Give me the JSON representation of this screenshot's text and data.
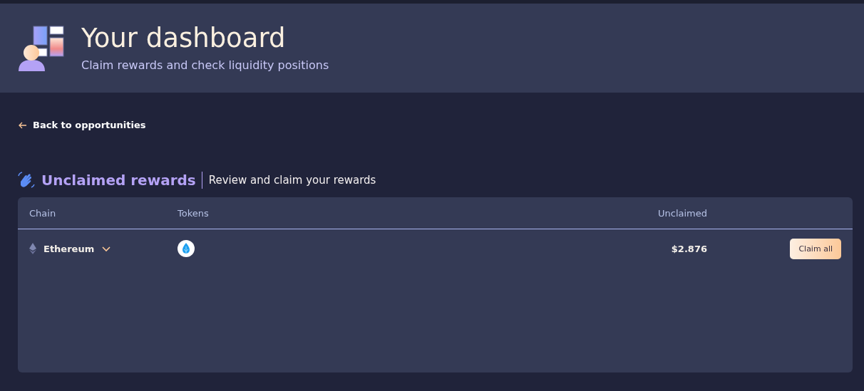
{
  "header": {
    "title": "Your dashboard",
    "subtitle": "Claim rewards and check liquidity positions"
  },
  "back_link": {
    "label": "Back to opportunities"
  },
  "section": {
    "title": "Unclaimed rewards",
    "subtitle": "Review and claim your rewards"
  },
  "table": {
    "columns": [
      "Chain",
      "Tokens",
      "Unclaimed"
    ],
    "rows": [
      {
        "chain": "Ethereum",
        "expanded": false,
        "amount": "$2.876",
        "action": "Claim all"
      }
    ]
  }
}
